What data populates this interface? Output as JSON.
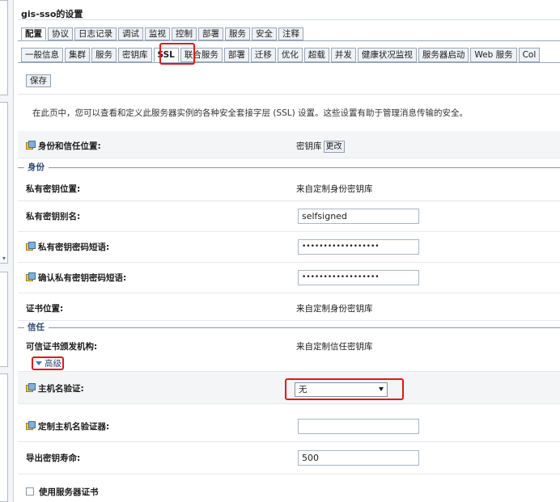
{
  "window": {
    "title": "gis-sso的设置"
  },
  "tabs_primary": [
    "配置",
    "协议",
    "日志记录",
    "调试",
    "监视",
    "控制",
    "部署",
    "服务",
    "安全",
    "注释"
  ],
  "tabs_primary_active": "配置",
  "tabs_secondary": [
    "一般信息",
    "集群",
    "服务",
    "密钥库",
    "SSL",
    "联合服务",
    "部署",
    "迁移",
    "优化",
    "超载",
    "并发",
    "健康状况监视",
    "服务器启动",
    "Web 服务",
    "Col"
  ],
  "tabs_secondary_active": "SSL",
  "toolbar": {
    "save_label": "保存"
  },
  "intro_text": "在此页中，您可以查看和定义此服务器实例的各种安全套接字层 (SSL) 设置。这些设置有助于管理消息传输的安全。",
  "identity_trust": {
    "label": "身份和信任位置:",
    "value": "密钥库",
    "change_button": "更改"
  },
  "section_identity": {
    "title": "身份"
  },
  "private_key_location": {
    "label": "私有密钥位置:",
    "value": "来自定制身份密钥库"
  },
  "private_key_alias": {
    "label": "私有密钥别名:",
    "value": "selfsigned"
  },
  "private_key_passphrase": {
    "label": "私有密钥密码短语:",
    "value": "••••••••••••••••••"
  },
  "confirm_passphrase": {
    "label": "确认私有密钥密码短语:",
    "value": "••••••••••••••••••"
  },
  "cert_location": {
    "label": "证书位置:",
    "value": "来自定制身份密钥库"
  },
  "section_trust": {
    "title": "信任"
  },
  "trusted_ca": {
    "label": "可信证书颁发机构:",
    "value": "来自定制信任密钥库"
  },
  "advanced": {
    "label": "高级"
  },
  "hostname_verification": {
    "label": "主机名验证:",
    "selected": "无"
  },
  "custom_hostname_verifier": {
    "label": "定制主机名验证器:",
    "value": ""
  },
  "export_key_lifespan": {
    "label": "导出密钥寿命:",
    "value": "500"
  },
  "use_server_certs": {
    "label": "使用服务器证书"
  },
  "colors": {
    "highlight": "#e0191b",
    "section_title": "#2b4b74",
    "tab_border": "#97a7b9"
  }
}
